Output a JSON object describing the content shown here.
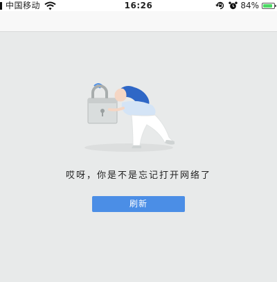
{
  "status_bar": {
    "carrier": "中国移动",
    "time": "16:26",
    "battery_percent": "84%",
    "battery_level": 0.84,
    "icons": [
      "signal-icon",
      "wifi-icon",
      "screen-rotation-lock-icon",
      "alarm-icon",
      "battery-icon"
    ]
  },
  "error_page": {
    "illustration": "no-network-illustration",
    "message": "哎呀，你是不是忘记打开网络了",
    "refresh_label": "刷新"
  },
  "colors": {
    "background": "#e8eaea",
    "button": "#4b8ee6",
    "battery_fill": "#4cd964"
  }
}
